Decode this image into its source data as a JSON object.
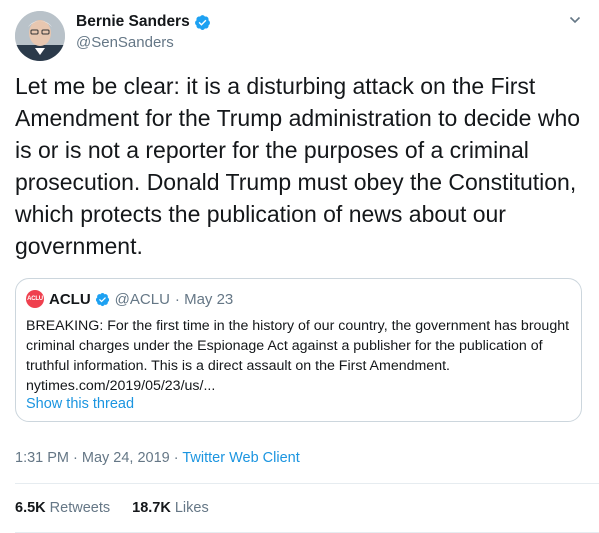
{
  "author": {
    "name": "Bernie Sanders",
    "handle": "@SenSanders"
  },
  "tweet": {
    "text": "Let me be clear: it is a disturbing attack on the First Amendment for the Trump administration to decide who is or is not a reporter for the purposes of a criminal prosecution. Donald Trump must obey the Constitution, which protects the publication of news about our government."
  },
  "quoted": {
    "logo_text": "ACLU",
    "name": "ACLU",
    "handle": "@ACLU",
    "date": "· May 23",
    "text": "BREAKING: For the first time in the history of our country, the government has brought criminal charges under the Espionage Act against a publisher for the publication of truthful information. This is a direct assault on the First Amendment. nytimes.com/2019/05/23/us/...",
    "show_thread": "Show this thread"
  },
  "meta": {
    "timestamp": "1:31 PM · May 24, 2019 · ",
    "client": "Twitter Web Client"
  },
  "stats": {
    "retweets_count": "6.5K",
    "retweets_label": "Retweets",
    "likes_count": "18.7K",
    "likes_label": "Likes"
  },
  "colors": {
    "accent": "#1b95e0",
    "verified": "#1da1f2",
    "secondary_text": "#657786",
    "aclu_red": "#ef404e"
  },
  "icons": {
    "verified": "verified-badge-icon",
    "caret": "chevron-down-icon"
  }
}
